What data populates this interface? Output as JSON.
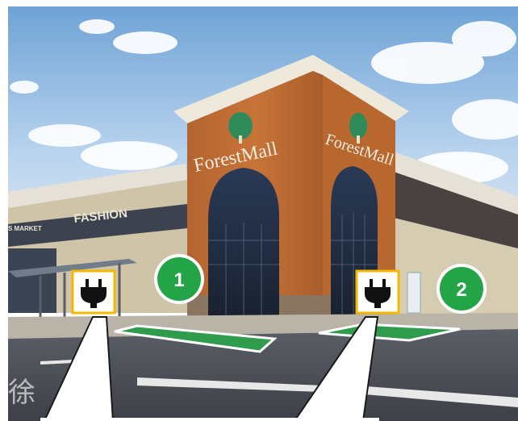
{
  "scene": {
    "sign_left": "ForestMall",
    "sign_right": "ForestMall",
    "fashion_sign": "FASHION",
    "left_store_sign": "S MARKET",
    "road_marking": "徐"
  },
  "markers": [
    {
      "number": "1",
      "color": "#22a447"
    },
    {
      "number": "2",
      "color": "#22a447"
    }
  ],
  "charger_icons": [
    {
      "icon": "plug-icon",
      "border_color": "#f5b800"
    },
    {
      "icon": "plug-icon",
      "border_color": "#f5b800"
    }
  ],
  "parking_space_color": "#2f9b4c"
}
